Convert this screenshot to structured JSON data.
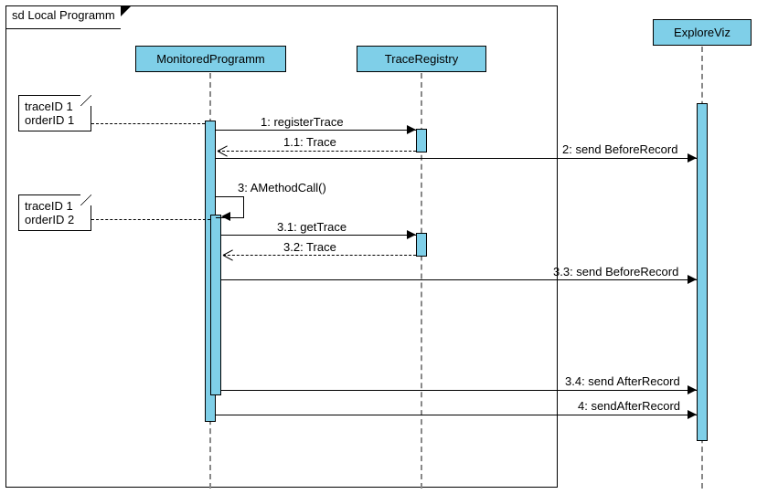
{
  "frame": {
    "title": "sd Local Programm"
  },
  "lifelines": {
    "monitored": "MonitoredProgramm",
    "registry": "TraceRegistry",
    "exploreviz": "ExploreViz"
  },
  "notes": {
    "n1": {
      "line1": "traceID 1",
      "line2": "orderID 1"
    },
    "n2": {
      "line1": "traceID 1",
      "line2": "orderID 2"
    }
  },
  "messages": {
    "m1": "1: registerTrace",
    "m11": "1.1: Trace",
    "m2": "2: send BeforeRecord",
    "m3": "3: AMethodCall()",
    "m31": "3.1: getTrace",
    "m32": "3.2: Trace",
    "m33": "3.3: send BeforeRecord",
    "m34": "3.4: send AfterRecord",
    "m4": "4: sendAfterRecord"
  }
}
